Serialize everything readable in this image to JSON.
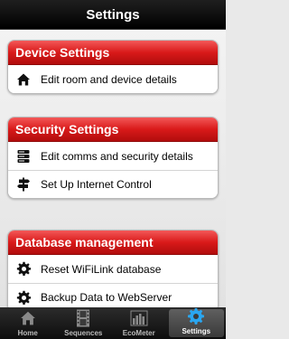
{
  "header": {
    "title": "Settings"
  },
  "sections": [
    {
      "title": "Device Settings",
      "items": [
        {
          "label": "Edit room and device details",
          "icon": "house-icon"
        }
      ]
    },
    {
      "title": "Security Settings",
      "items": [
        {
          "label": "Edit comms and security details",
          "icon": "server-stack-icon"
        },
        {
          "label": "Set Up Internet Control",
          "icon": "signpost-icon"
        }
      ]
    },
    {
      "title": "Database management",
      "items": [
        {
          "label": "Reset WiFiLink database",
          "icon": "gear-icon"
        },
        {
          "label": "Backup Data to WebServer",
          "icon": "gear-icon"
        }
      ]
    }
  ],
  "tabbar": {
    "tabs": [
      {
        "label": "Home",
        "icon": "home-icon"
      },
      {
        "label": "Sequences",
        "icon": "film-icon"
      },
      {
        "label": "EcoMeter",
        "icon": "bar-chart-icon"
      },
      {
        "label": "Settings",
        "icon": "gear-icon",
        "active": true
      }
    ]
  },
  "colors": {
    "accent_red": "#d91a1a",
    "bar_black": "#000000",
    "active_tab_icon": "#2aa6f0"
  }
}
